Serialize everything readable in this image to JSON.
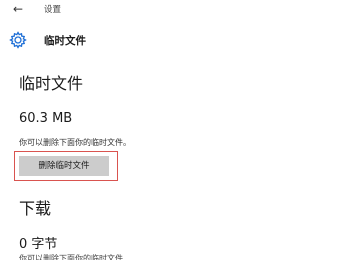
{
  "window": {
    "back_glyph": "←",
    "title": "设置"
  },
  "header": {
    "icon": "gear-icon",
    "title": "临时文件"
  },
  "temp_files": {
    "heading": "临时文件",
    "size": "60.3 MB",
    "description": "你可以删除下面你的临时文件。",
    "delete_button": "删除临时文件"
  },
  "downloads": {
    "heading": "下载",
    "size": "0 字节",
    "description_partial": "你可以删除下面你的临时文件"
  },
  "colors": {
    "highlight": "#d9534f",
    "button_bg": "#cccccc",
    "accent": "#1e6fd6"
  }
}
